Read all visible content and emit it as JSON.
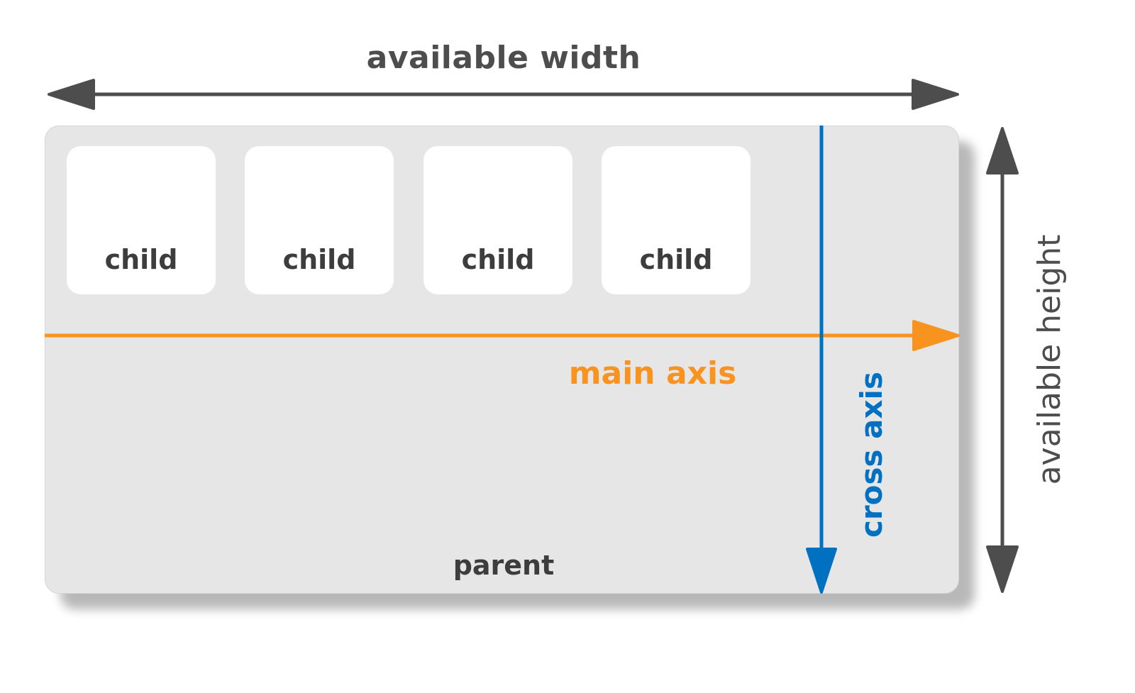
{
  "diagram": {
    "title_width": "available width",
    "title_height": "available height",
    "parent_label": "parent",
    "main_axis_label": "main axis",
    "cross_axis_label": "cross axis",
    "children": [
      {
        "label": "child"
      },
      {
        "label": "child"
      },
      {
        "label": "child"
      },
      {
        "label": "child"
      }
    ]
  },
  "colors": {
    "dark_gray": "#4d4d4d",
    "main_axis": "#f7931e",
    "cross_axis": "#0070c0",
    "parent_fill": "#e6e6e6",
    "child_fill": "#ffffff"
  },
  "icons": {
    "width_arrow": "double-headed-horizontal-arrow",
    "height_arrow": "double-headed-vertical-arrow",
    "main_axis_arrow": "right-arrow",
    "cross_axis_arrow": "down-arrow"
  }
}
